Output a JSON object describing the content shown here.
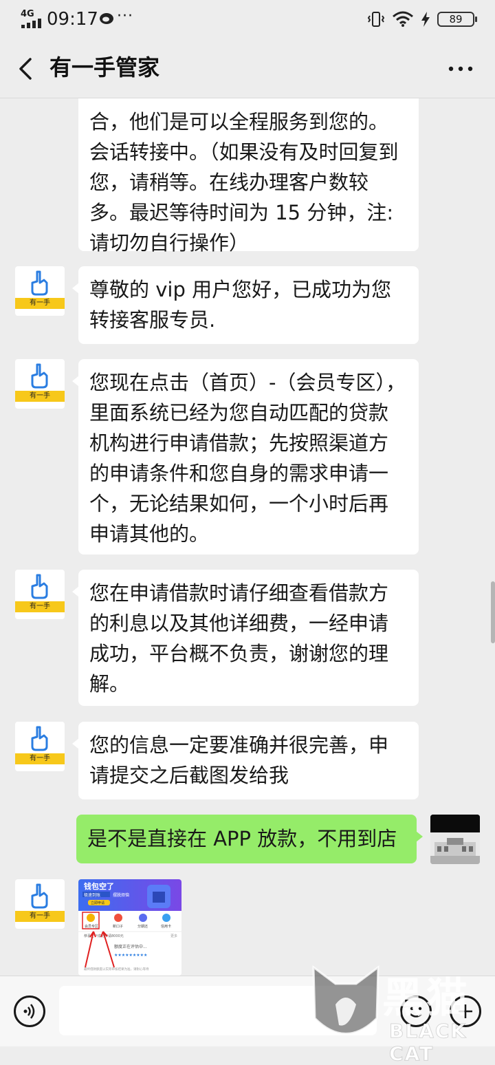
{
  "status_bar": {
    "network": "4G",
    "time": "09:17",
    "battery": "89"
  },
  "nav": {
    "title": "有一手管家"
  },
  "avatar_label": "有一手",
  "messages": [
    {
      "text": "合，他们是可以全程服务到您的。会话转接中。（如果没有及时回复到您，请稍等。在线办理客户数较多。最迟等待时间为 15 分钟，注:请切勿自行操作）"
    },
    {
      "text": "尊敬的 vip 用户您好，已成功为您转接客服专员."
    },
    {
      "text": "您现在点击（首页）-（会员专区），里面系统已经为您自动匹配的贷款机构进行申请借款；先按照渠道方的申请条件和您自身的需求申请一个，无论结果如何，一个小时后再申请其他的。"
    },
    {
      "text": "您在申请借款时请仔细查看借款方的利息以及其他详细费，一经申请成功，平台概不负责，谢谢您的理解。"
    },
    {
      "text": "您的信息一定要准确并很完善，申请提交之后截图发给我"
    },
    {
      "text": "是不是直接在 APP 放款，不用到店"
    }
  ],
  "thumb": {
    "banner_title": "钱包空了",
    "banner_sub1": "极速到账",
    "banner_sub2": "摆脱烦恼",
    "banner_btn": "立即申请",
    "icons": [
      "会员专区",
      "新口子",
      "分期还",
      "信用卡"
    ],
    "notice": "恭喜王**成功申请8000元",
    "notice_more": "更多",
    "status": "额度正在评估中...",
    "stars": "★★★★★★★★★",
    "footer": "最终借款额度以实际审核结果为准，请耐心等待"
  },
  "watermark": {
    "cn": "黑猫",
    "en": "BLACK CAT"
  },
  "colors": {
    "background": "#ededed",
    "bubble_self": "#95ec69",
    "bubble_other": "#ffffff",
    "avatar_band": "#f7c81a",
    "avatar_hand": "#2a7de1"
  }
}
